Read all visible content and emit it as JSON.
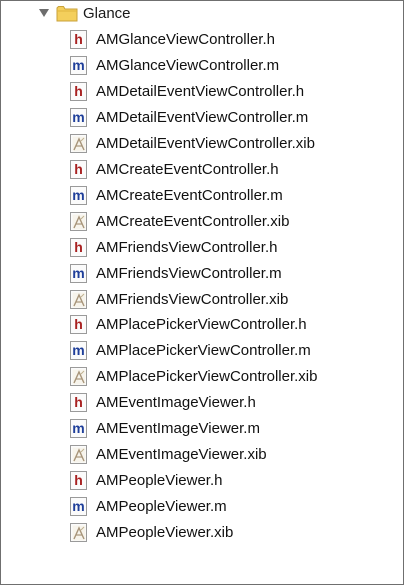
{
  "navigator": {
    "group": {
      "name": "Glance",
      "expanded": true,
      "icon": "folder-icon"
    },
    "files": [
      {
        "name": "AMGlanceViewController.h",
        "type": "h",
        "icon": "header-file-icon"
      },
      {
        "name": "AMGlanceViewController.m",
        "type": "m",
        "icon": "implementation-file-icon"
      },
      {
        "name": "AMDetailEventViewController.h",
        "type": "h",
        "icon": "header-file-icon"
      },
      {
        "name": "AMDetailEventViewController.m",
        "type": "m",
        "icon": "implementation-file-icon"
      },
      {
        "name": "AMDetailEventViewController.xib",
        "type": "xib",
        "icon": "xib-file-icon"
      },
      {
        "name": "AMCreateEventController.h",
        "type": "h",
        "icon": "header-file-icon"
      },
      {
        "name": "AMCreateEventController.m",
        "type": "m",
        "icon": "implementation-file-icon"
      },
      {
        "name": "AMCreateEventController.xib",
        "type": "xib",
        "icon": "xib-file-icon"
      },
      {
        "name": "AMFriendsViewController.h",
        "type": "h",
        "icon": "header-file-icon"
      },
      {
        "name": "AMFriendsViewController.m",
        "type": "m",
        "icon": "implementation-file-icon"
      },
      {
        "name": "AMFriendsViewController.xib",
        "type": "xib",
        "icon": "xib-file-icon"
      },
      {
        "name": "AMPlacePickerViewController.h",
        "type": "h",
        "icon": "header-file-icon"
      },
      {
        "name": "AMPlacePickerViewController.m",
        "type": "m",
        "icon": "implementation-file-icon"
      },
      {
        "name": "AMPlacePickerViewController.xib",
        "type": "xib",
        "icon": "xib-file-icon"
      },
      {
        "name": "AMEventImageViewer.h",
        "type": "h",
        "icon": "header-file-icon"
      },
      {
        "name": "AMEventImageViewer.m",
        "type": "m",
        "icon": "implementation-file-icon"
      },
      {
        "name": "AMEventImageViewer.xib",
        "type": "xib",
        "icon": "xib-file-icon"
      },
      {
        "name": "AMPeopleViewer.h",
        "type": "h",
        "icon": "header-file-icon"
      },
      {
        "name": "AMPeopleViewer.m",
        "type": "m",
        "icon": "implementation-file-icon"
      },
      {
        "name": "AMPeopleViewer.xib",
        "type": "xib",
        "icon": "xib-file-icon"
      }
    ]
  },
  "badges": {
    "h": "h",
    "m": "m"
  },
  "colors": {
    "header_badge": "#a82121",
    "implementation_badge": "#1f3f9a",
    "folder": "#f2c94c",
    "border": "#6f6f6f"
  }
}
